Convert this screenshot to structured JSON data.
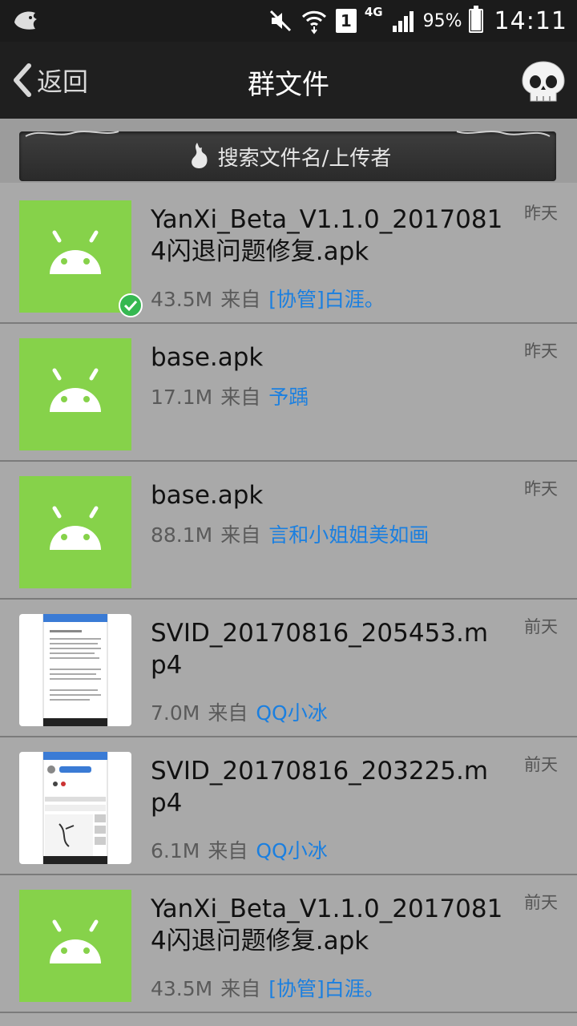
{
  "status_bar": {
    "network": "4G",
    "sim_slot": "1",
    "battery_percent": "95%",
    "battery_level": 0.95,
    "time": "14:11"
  },
  "title_bar": {
    "back_label": "返回",
    "title": "群文件"
  },
  "search": {
    "placeholder": "搜索文件名/上传者"
  },
  "labels": {
    "from": "来自"
  },
  "files": [
    {
      "name": "YanXi_Beta_V1.1.0_20170814闪退问题修复.apk",
      "size": "43.5M",
      "uploader": "[协管]白涯。",
      "when": "昨天",
      "type": "apk",
      "downloaded": true
    },
    {
      "name": "base.apk",
      "size": "17.1M",
      "uploader": "予踽",
      "when": "昨天",
      "type": "apk",
      "downloaded": false
    },
    {
      "name": "base.apk",
      "size": "88.1M",
      "uploader": "言和小姐姐美如画",
      "when": "昨天",
      "type": "apk",
      "downloaded": false
    },
    {
      "name": "SVID_20170816_205453.mp4",
      "size": "7.0M",
      "uploader": "QQ小冰",
      "when": "前天",
      "type": "video",
      "downloaded": false
    },
    {
      "name": "SVID_20170816_203225.mp4",
      "size": "6.1M",
      "uploader": "QQ小冰",
      "when": "前天",
      "type": "video",
      "downloaded": false
    },
    {
      "name": "YanXi_Beta_V1.1.0_20170814闪退问题修复.apk",
      "size": "43.5M",
      "uploader": "[协管]白涯。",
      "when": "前天",
      "type": "apk",
      "downloaded": false
    }
  ],
  "colors": {
    "apk_bg": "#86d24a",
    "uploader": "#1a7fe0",
    "downloaded_check": "#35b851"
  }
}
